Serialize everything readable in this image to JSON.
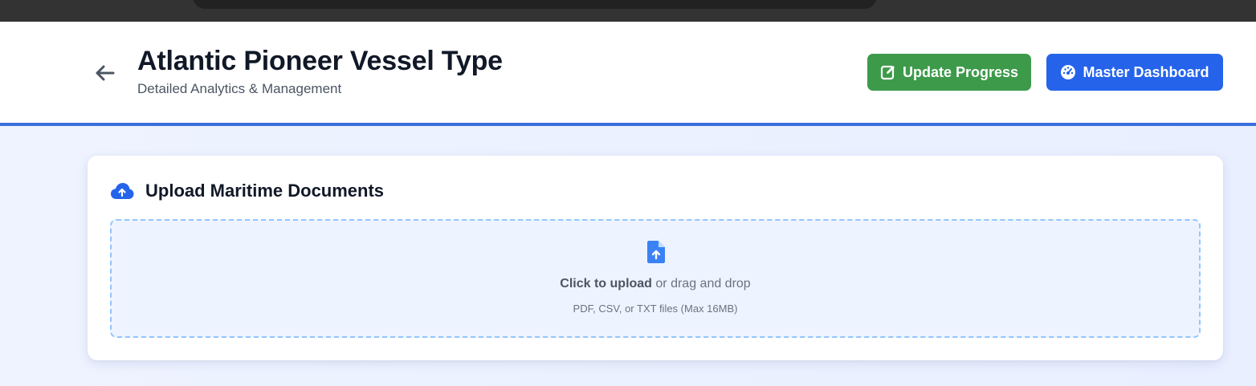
{
  "header": {
    "title": "Atlantic Pioneer Vessel Type",
    "subtitle": "Detailed Analytics & Management",
    "back_icon": "arrow-left-icon",
    "buttons": {
      "update_label": "Update Progress",
      "update_icon": "edit-icon",
      "update_color": "#3d9a4a",
      "master_label": "Master Dashboard",
      "master_icon": "dashboard-gauge-icon",
      "master_color": "#2563eb"
    },
    "accent_color": "#3b6fdc"
  },
  "upload": {
    "title": "Upload Maritime Documents",
    "title_icon": "cloud-upload-icon",
    "file_icon": "file-upload-icon",
    "click_text": "Click to upload",
    "rest_text": " or drag and drop",
    "hint": "PDF, CSV, or TXT files (Max 16MB)"
  }
}
